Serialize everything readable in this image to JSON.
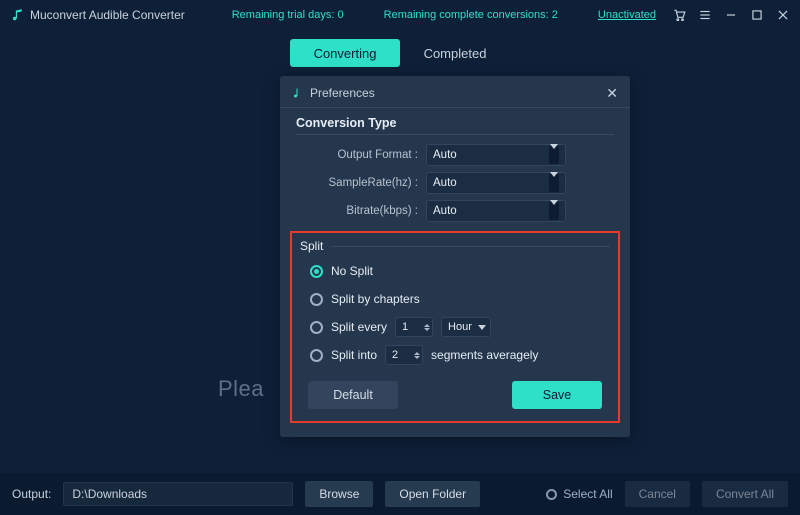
{
  "titlebar": {
    "appName": "Muconvert Audible Converter",
    "trialDaysLabel": "Remaining trial days: ",
    "trialDays": "0",
    "conversionsLabel": "Remaining complete conversions: ",
    "conversions": "2",
    "unactivated": "Unactivated"
  },
  "tabs": {
    "converting": "Converting",
    "completed": "Completed"
  },
  "main": {
    "placeholderVisiblePart": "Plea"
  },
  "dialog": {
    "title": "Preferences",
    "conversionType": {
      "heading": "Conversion Type",
      "outputFormatLabel": "Output Format :",
      "outputFormatValue": "Auto",
      "sampleRateLabel": "SampleRate(hz) :",
      "sampleRateValue": "Auto",
      "bitrateLabel": "Bitrate(kbps) :",
      "bitrateValue": "Auto"
    },
    "split": {
      "heading": "Split",
      "noSplit": "No Split",
      "byChapters": "Split by chapters",
      "everyPrefix": "Split every",
      "everyValue": "1",
      "everyUnit": "Hour",
      "intoPrefix": "Split into",
      "intoValue": "2",
      "intoSuffix": "segments averagely",
      "selected": "noSplit"
    },
    "buttons": {
      "default": "Default",
      "save": "Save"
    }
  },
  "footer": {
    "outputLabel": "Output:",
    "outputPath": "D:\\Downloads",
    "browse": "Browse",
    "openFolder": "Open Folder",
    "selectAll": "Select All",
    "cancel": "Cancel",
    "convertAll": "Convert All"
  }
}
